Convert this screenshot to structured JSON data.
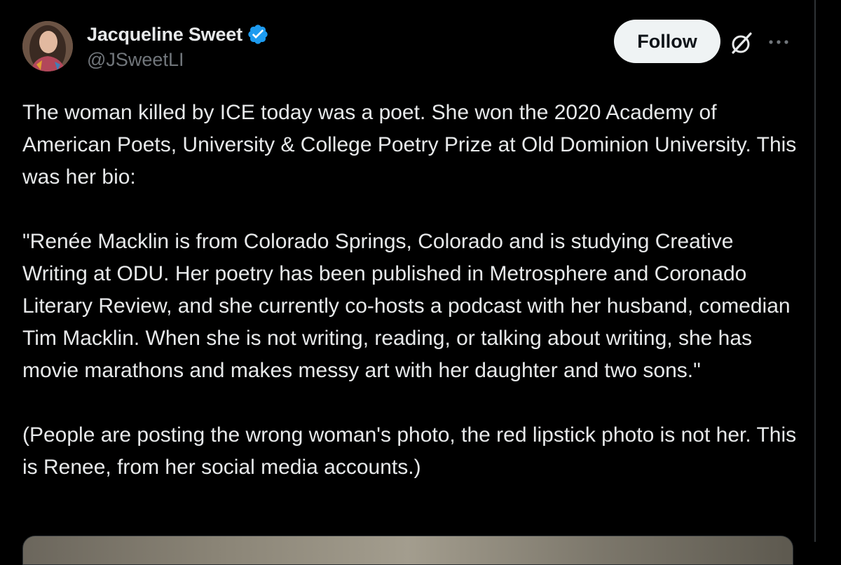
{
  "author": {
    "display_name": "Jacqueline Sweet",
    "handle": "@JSweetLI",
    "verified": true,
    "verified_color": "#1d9bf0"
  },
  "actions": {
    "follow_label": "Follow",
    "grok_icon": "grok-icon",
    "more_icon": "more-icon"
  },
  "tweet": {
    "paragraphs": [
      "The woman killed by ICE today was a poet. She won the 2020 Academy of American Poets, University & College Poetry Prize at Old Dominion University. This was her bio:",
      "\"Renée Macklin is from Colorado Springs, Colorado and is studying Creative Writing at ODU. Her poetry has been published in Metrosphere and Coronado Literary Review, and she currently co-hosts a podcast with her husband, comedian Tim Macklin. When she is not writing, reading, or talking about writing, she has movie marathons and makes messy art with her daughter and two sons.\"",
      "(People are posting the wrong woman's photo, the red lipstick photo is not her. This is Renee, from her social media accounts.)"
    ]
  },
  "theme": {
    "background": "#000000",
    "text": "#e7e9ea",
    "secondary_text": "#71767b",
    "follow_bg": "#eff3f4"
  }
}
